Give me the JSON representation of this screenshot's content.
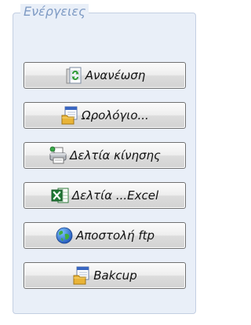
{
  "actions": {
    "title": "Ενέργειες",
    "buttons": [
      {
        "label": "Ανανέωση",
        "icon": "refresh-document-icon"
      },
      {
        "label": "Ωρολόγιο...",
        "icon": "calendar-schedule-icon"
      },
      {
        "label": "Δελτία κίνησης",
        "icon": "printer-icon"
      },
      {
        "label": "Δελτία ...Excel",
        "icon": "excel-icon"
      },
      {
        "label": "Αποστολή ftp",
        "icon": "globe-icon"
      },
      {
        "label": "Bakcup",
        "icon": "calendar-backup-icon"
      }
    ]
  }
}
